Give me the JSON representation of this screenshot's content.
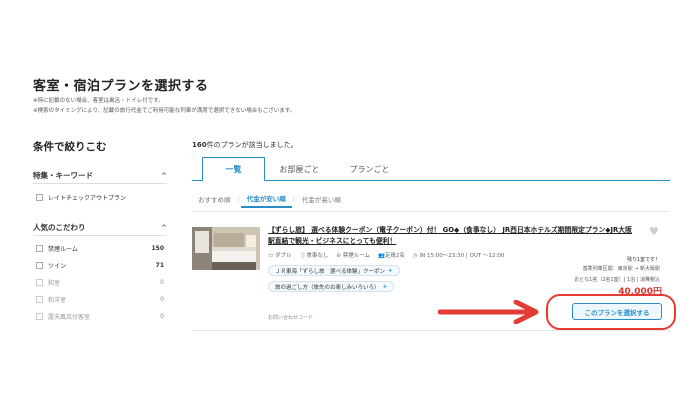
{
  "page": {
    "title": "客室・宿泊プランを選択する",
    "notes": [
      "※特に記載のない場合、客室は風呂・トイレ付です。",
      "※検索のタイミングにより、記載の旅行代金でご利用可能な列車が満席で選択できない場合もございます。"
    ]
  },
  "sidebar": {
    "title": "条件で絞りこむ",
    "sections": [
      {
        "heading": "特集・キーワード",
        "items": [
          {
            "label": "レイトチェックアウトプラン",
            "count": ""
          }
        ]
      },
      {
        "heading": "人気のこだわり",
        "items": [
          {
            "label": "禁煙ルーム",
            "count": "150"
          },
          {
            "label": "ツイン",
            "count": "71"
          },
          {
            "label": "和室",
            "count": "0"
          },
          {
            "label": "和洋室",
            "count": "0"
          },
          {
            "label": "露天風呂付客室",
            "count": "0"
          }
        ]
      }
    ],
    "chevron": "^"
  },
  "main": {
    "count_number": "160",
    "count_suffix": "件のプランが該当しました。",
    "tabs": [
      "一覧",
      "お部屋ごと",
      "プランごと"
    ],
    "sort_options": [
      "おすすめ順",
      "代金が安い順",
      "代金が高い順"
    ],
    "plan": {
      "name": "【ずらし旅】 選べる体験クーポン（電子クーポン）付！ GO◆（食事なし） JR西日本ホテルズ期間限定プラン◆JR大阪駅直結で観光・ビジネスにとっても便利！",
      "amenities": [
        "ダブル",
        "食事なし",
        "禁煙ルーム",
        "定員2名",
        "IN 15:00〜23:30 | OUT 〜12:00"
      ],
      "amenity_icons": [
        "bed-icon",
        "meal-icon",
        "no-smoking-icon",
        "people-icon",
        "clock-icon"
      ],
      "tags": [
        "ＪＲ東海「ずらし旅　選べる体験」クーポン",
        "旅の過ごし方（旅先のお楽しみいろいろ）"
      ],
      "inquiry": "お問い合わせコード",
      "availability": "残り1室です！",
      "route": "基準列車区間：東京駅 → 新大阪駅",
      "fare_note": "おとな1名（2名1室）| 1泊 | 消費税込",
      "price": "40,000円",
      "select_label": "このプランを選択する"
    }
  },
  "colors": {
    "accent": "#2a8dc8",
    "price": "#d9352f",
    "annotation": "#e53b35"
  }
}
